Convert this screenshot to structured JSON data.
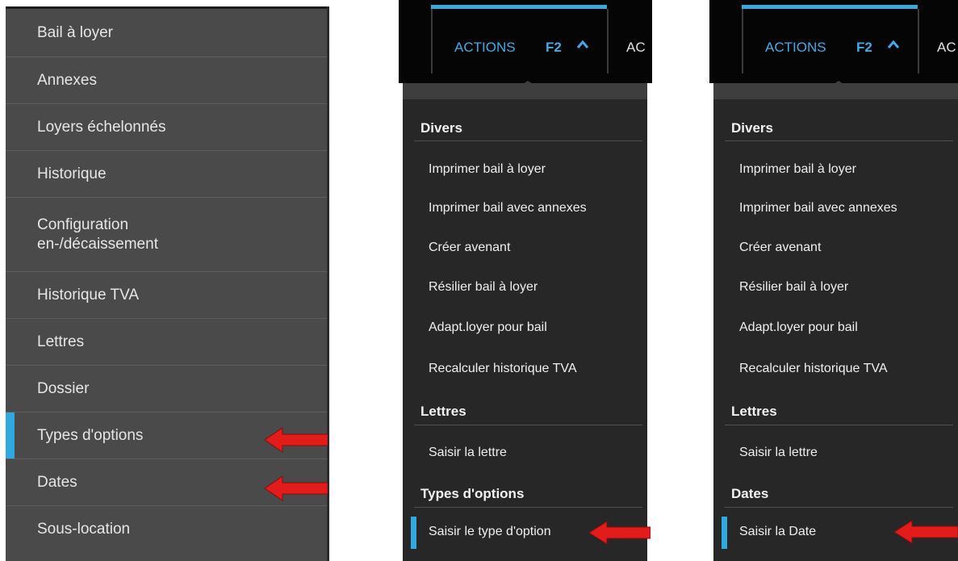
{
  "sidebar": {
    "items": [
      {
        "label": "Bail à loyer",
        "active": false
      },
      {
        "label": "Annexes",
        "active": false
      },
      {
        "label": "Loyers échelonnés",
        "active": false
      },
      {
        "label": "Historique",
        "active": false
      },
      {
        "label": "Configuration\nen-/décaissement",
        "active": false
      },
      {
        "label": "Historique TVA",
        "active": false
      },
      {
        "label": "Lettres",
        "active": false
      },
      {
        "label": "Dossier",
        "active": false
      },
      {
        "label": "Types d'options",
        "active": true
      },
      {
        "label": "Dates",
        "active": false
      },
      {
        "label": "Sous-location",
        "active": false
      }
    ]
  },
  "panel_a": {
    "tab_label": "ACTIONS",
    "tab_key": "F2",
    "next_tab_partial": "AC",
    "sections": [
      {
        "title": "Divers",
        "items": [
          "Imprimer bail à loyer",
          "Imprimer bail avec annexes",
          "Créer avenant",
          "Résilier bail à loyer",
          "Adapt.loyer pour bail",
          "Recalculer historique TVA"
        ]
      },
      {
        "title": "Lettres",
        "items": [
          "Saisir la lettre"
        ]
      },
      {
        "title": "Types d'options",
        "items": [
          "Saisir le type d'option"
        ]
      }
    ]
  },
  "panel_b": {
    "tab_label": "ACTIONS",
    "tab_key": "F2",
    "next_tab_partial": "AC",
    "sections": [
      {
        "title": "Divers",
        "items": [
          "Imprimer bail à loyer",
          "Imprimer bail avec annexes",
          "Créer avenant",
          "Résilier bail à loyer",
          "Adapt.loyer pour bail",
          "Recalculer historique TVA"
        ]
      },
      {
        "title": "Lettres",
        "items": [
          "Saisir la lettre"
        ]
      },
      {
        "title": "Dates",
        "items": [
          "Saisir la Date"
        ]
      }
    ]
  },
  "colors": {
    "accent": "#2fa9e0",
    "arrow": "#e21b1b",
    "sidebar_bg": "#4a4a4a",
    "menu_bg": "#272727"
  }
}
